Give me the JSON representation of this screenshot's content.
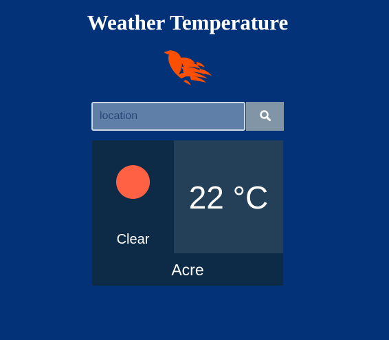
{
  "header": {
    "title": "Weather Temperature",
    "logo_icon": "phoenix-flame-logo-icon",
    "logo_color": "#fd4f00"
  },
  "search": {
    "placeholder": "location",
    "value": "",
    "button_icon": "search-icon"
  },
  "weather": {
    "condition": "Clear",
    "condition_icon": "sun-icon",
    "temperature": "22 °C",
    "location": "Acre"
  },
  "colors": {
    "background": "#043278",
    "sun": "#ff6144",
    "card_dark": "#0d2a47",
    "card_mid": "#244058",
    "button": "#8195a6"
  }
}
